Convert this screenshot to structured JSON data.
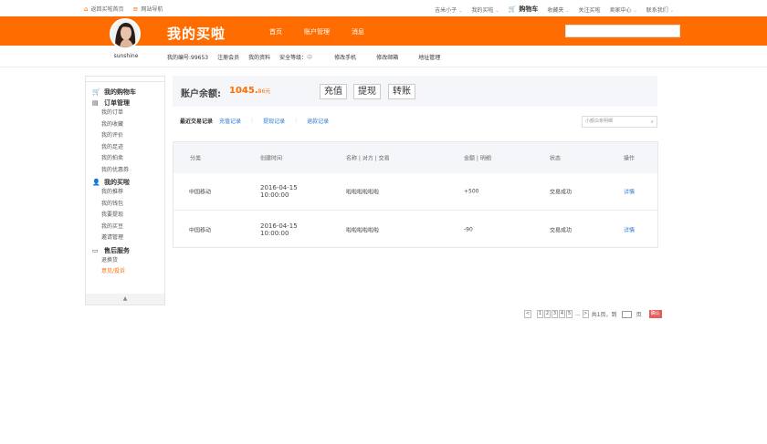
{
  "topbar": {
    "home_link": "返回买啦首页",
    "site_nav": "网站导航",
    "user": "吉米小子",
    "my_buy": "我的买啦",
    "cart": "购物车",
    "favorites": "收藏夹",
    "follow": "关注买啦",
    "seller_center": "卖家中心",
    "contact": "联系我们"
  },
  "header": {
    "brand": "我的买啦",
    "nav": [
      "首页",
      "账户管理",
      "消息"
    ],
    "active_nav": 1
  },
  "profile": {
    "username": "sunshine"
  },
  "subnav": {
    "member_no": "我的编号:99653",
    "register": "注册会员",
    "profile": "我的资料",
    "security_label": "安全等级：",
    "security_level": "中",
    "edit_phone": "修改手机",
    "edit_email": "修改邮箱",
    "address": "地址管理"
  },
  "sidebar": {
    "groups": [
      {
        "icon": "cart-icon",
        "title": "我的购物车",
        "items": []
      },
      {
        "icon": "order-icon",
        "title": "订单管理",
        "items": [
          "我的订单",
          "我的收藏",
          "我的评价",
          "我的足迹",
          "我的拍卖",
          "我的优惠券"
        ]
      },
      {
        "icon": "user-icon",
        "title": "我的买啦",
        "items": [
          "我的推荐",
          "我的钱包",
          "我要提现",
          "我的买豆",
          "邀请管理"
        ]
      },
      {
        "icon": "service-icon",
        "title": "售后服务",
        "items": [
          "退换货",
          "意见/投诉"
        ]
      }
    ],
    "highlight_item": "意见/投诉",
    "collapse": "▲"
  },
  "balance": {
    "label": "账户余额:",
    "amount": "1045.",
    "fraction": "86元",
    "buttons": [
      "充值",
      "提现",
      "转账"
    ]
  },
  "records": {
    "title": "最近交易记录",
    "tabs": [
      "充值记录",
      "提现记录",
      "退款记录"
    ],
    "search_placeholder": "小额白条明细"
  },
  "table": {
    "headers": [
      "分类",
      "创建时间",
      "名称 | 对方 | 交易",
      "金额 | 明细",
      "状态",
      "操作"
    ],
    "rows": [
      {
        "category": "中国移动",
        "date": "2016-04-15",
        "time": "10:00:00",
        "name": "啦啦啦啦啦啦",
        "amount": "+500",
        "status": "交易成功",
        "action": "详情"
      },
      {
        "category": "中国移动",
        "date": "2016-04-15",
        "time": "10:00:00",
        "name": "啦啦啦啦啦啦",
        "amount": "-90",
        "status": "交易成功",
        "action": "详情"
      }
    ]
  },
  "pager": {
    "prev": "<",
    "pages": [
      "1",
      "2",
      "3",
      "4",
      "5"
    ],
    "ellipsis": "...",
    "next": ">",
    "total": "共1页，到",
    "page_unit": "页",
    "confirm": "确认"
  },
  "colors": {
    "accent": "#ff6c00",
    "link": "#2a7ad2"
  }
}
